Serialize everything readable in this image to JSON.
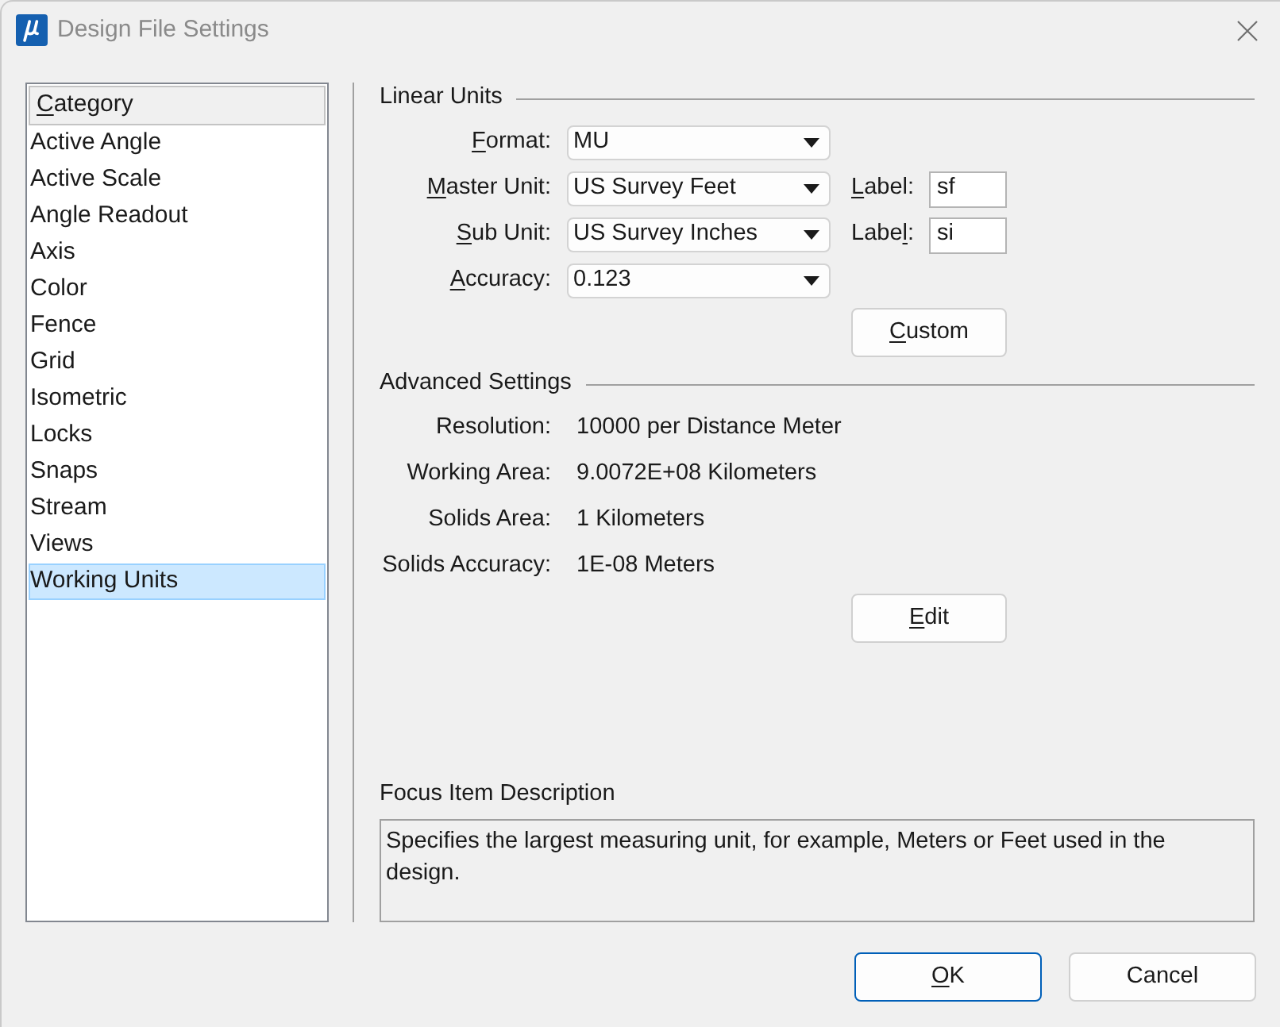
{
  "window": {
    "title": "Design File Settings"
  },
  "category_list": {
    "header": {
      "label_parts": [
        {
          "text": "C",
          "access_key": true
        },
        {
          "text": "ategory",
          "access_key": false
        }
      ]
    },
    "items": [
      {
        "label": "Active Angle",
        "selected": false
      },
      {
        "label": "Active Scale",
        "selected": false
      },
      {
        "label": "Angle Readout",
        "selected": false
      },
      {
        "label": "Axis",
        "selected": false
      },
      {
        "label": "Color",
        "selected": false
      },
      {
        "label": "Fence",
        "selected": false
      },
      {
        "label": "Grid",
        "selected": false
      },
      {
        "label": "Isometric",
        "selected": false
      },
      {
        "label": "Locks",
        "selected": false
      },
      {
        "label": "Snaps",
        "selected": false
      },
      {
        "label": "Stream",
        "selected": false
      },
      {
        "label": "Views",
        "selected": false
      },
      {
        "label": "Working Units",
        "selected": true
      }
    ]
  },
  "linear_units": {
    "title": "Linear Units",
    "fields": [
      {
        "label_parts": [
          {
            "text": "F",
            "access_key": true
          },
          {
            "text": "ormat:",
            "access_key": false
          }
        ],
        "value": "MU"
      },
      {
        "label_parts": [
          {
            "text": "M",
            "access_key": true
          },
          {
            "text": "aster Unit:",
            "access_key": false
          }
        ],
        "value": "US Survey Feet",
        "unit_label": {
          "label_parts": [
            {
              "text": "L",
              "access_key": true
            },
            {
              "text": "abel:",
              "access_key": false
            }
          ],
          "value": "sf"
        }
      },
      {
        "label_parts": [
          {
            "text": "S",
            "access_key": true
          },
          {
            "text": "ub Unit:",
            "access_key": false
          }
        ],
        "value": "US Survey Inches",
        "unit_label": {
          "label_parts": [
            {
              "text": "Labe",
              "access_key": false
            },
            {
              "text": "l",
              "access_key": true
            },
            {
              "text": ":",
              "access_key": false
            }
          ],
          "value": "si"
        }
      },
      {
        "label_parts": [
          {
            "text": "A",
            "access_key": true
          },
          {
            "text": "ccuracy:",
            "access_key": false
          }
        ],
        "value": "0.123"
      }
    ],
    "button": {
      "label_parts": [
        {
          "text": "C",
          "access_key": true
        },
        {
          "text": "ustom",
          "access_key": false
        }
      ]
    }
  },
  "advanced_settings": {
    "title": "Advanced Settings",
    "rows": [
      {
        "label": "Resolution:",
        "value": "10000 per Distance Meter"
      },
      {
        "label": "Working Area:",
        "value": "9.0072E+08 Kilometers"
      },
      {
        "label": "Solids Area:",
        "value": "1 Kilometers"
      },
      {
        "label": "Solids Accuracy:",
        "value": "1E-08 Meters"
      }
    ],
    "button": {
      "label_parts": [
        {
          "text": "E",
          "access_key": true
        },
        {
          "text": "dit",
          "access_key": false
        }
      ]
    }
  },
  "focus_item_description": {
    "title": "Focus Item Description",
    "text": "Specifies the largest measuring unit, for example, Meters or Feet used in the design."
  },
  "buttons": [
    {
      "label_parts": [
        {
          "text": "O",
          "access_key": true
        },
        {
          "text": "K",
          "access_key": false
        }
      ],
      "default": true
    },
    {
      "label_parts": [
        {
          "text": "Cancel",
          "access_key": false
        }
      ],
      "default": false
    }
  ]
}
